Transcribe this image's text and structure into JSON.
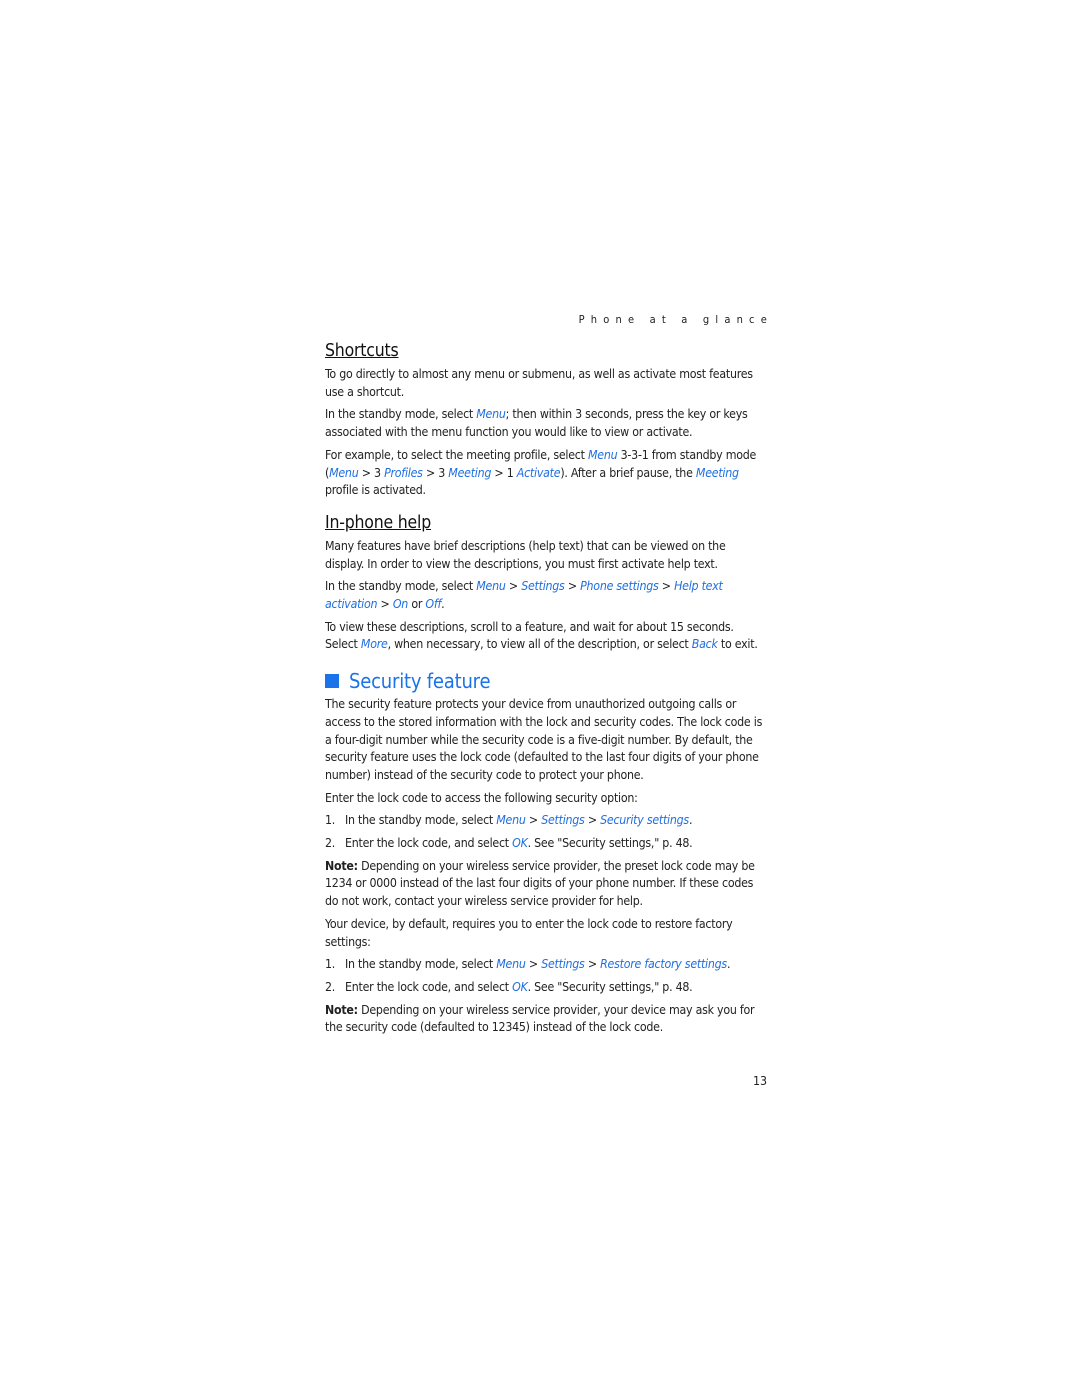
{
  "running_head": "Phone at a glance",
  "page_number": "13",
  "link_color": "#1f6fe0",
  "heading_color": "#1a73e8",
  "shortcuts": {
    "title": "Shortcuts",
    "p1": "To go directly to almost any menu or submenu, as well as activate most features use a shortcut.",
    "p2": {
      "a": "In the standby mode, select ",
      "menu": "Menu",
      "b": "; then within 3 seconds, press the key or keys associated with the menu function you would like to view or activate."
    },
    "p3": {
      "a": "For example, to select the meeting profile, select ",
      "menu": "Menu",
      "b": " 3-3-1 from standby mode (",
      "menu2": "Menu",
      "c": " > 3 ",
      "profiles": "Profiles",
      "d": " > 3 ",
      "meeting": "Meeting",
      "e": " > 1 ",
      "activate": "Activate",
      "f": "). After a brief pause, the ",
      "meeting2": "Meeting",
      "g": " profile is activated."
    }
  },
  "inphone_help": {
    "title": "In-phone help",
    "p1": "Many features have brief descriptions (help text) that can be viewed on the display. In order to view the descriptions, you must first activate help text.",
    "p2": {
      "a": "In the standby mode, select ",
      "menu": "Menu",
      "sep1": " > ",
      "settings": "Settings",
      "sep2": " > ",
      "phone_settings": "Phone settings",
      "sep3": " > ",
      "help_text_activation": "Help text activation",
      "sep4": " > ",
      "on": "On",
      "or": " or ",
      "off": "Off",
      "end": "."
    },
    "p3": {
      "a": "To view these descriptions, scroll to a feature, and wait for about 15 seconds. Select ",
      "more": "More",
      "b": ", when necessary, to view all of the description, or select ",
      "back": "Back",
      "c": " to exit."
    }
  },
  "security": {
    "title": "Security feature",
    "p1": "The security feature protects your device from unauthorized outgoing calls or access to the stored information with the lock and security codes. The lock code is a four-digit number while the security code is a five-digit number. By default, the security feature uses the lock code (defaulted to the last four digits of your phone number) instead of the security code to protect your phone.",
    "p2": "Enter the lock code to access the following security option:",
    "steps1": [
      {
        "num": "1.",
        "a": "In the standby mode, select ",
        "menu": "Menu",
        "sep1": " > ",
        "settings": "Settings",
        "sep2": " > ",
        "target": "Security settings",
        "end": "."
      },
      {
        "num": "2.",
        "a": "Enter the lock code, and select ",
        "ok": "OK",
        "b": ". See \"Security settings,\" p. 48."
      }
    ],
    "note1": {
      "label": "Note:",
      "text": " Depending on your wireless service provider, the preset lock code may be 1234 or 0000 instead of the last four digits of your phone number. If these codes do not work, contact your wireless service provider for help."
    },
    "p3": "Your device, by default, requires you to enter the lock code to restore factory settings:",
    "steps2": [
      {
        "num": "1.",
        "a": "In the standby mode, select ",
        "menu": "Menu",
        "sep1": " > ",
        "settings": "Settings",
        "sep2": " > ",
        "target": "Restore factory settings",
        "end": "."
      },
      {
        "num": "2.",
        "a": "Enter the lock code, and select ",
        "ok": "OK",
        "b": ". See \"Security settings,\" p. 48."
      }
    ],
    "note2": {
      "label": "Note:",
      "text": " Depending on your wireless service provider, your device may ask you for the security code (defaulted to 12345) instead of the lock code."
    }
  }
}
